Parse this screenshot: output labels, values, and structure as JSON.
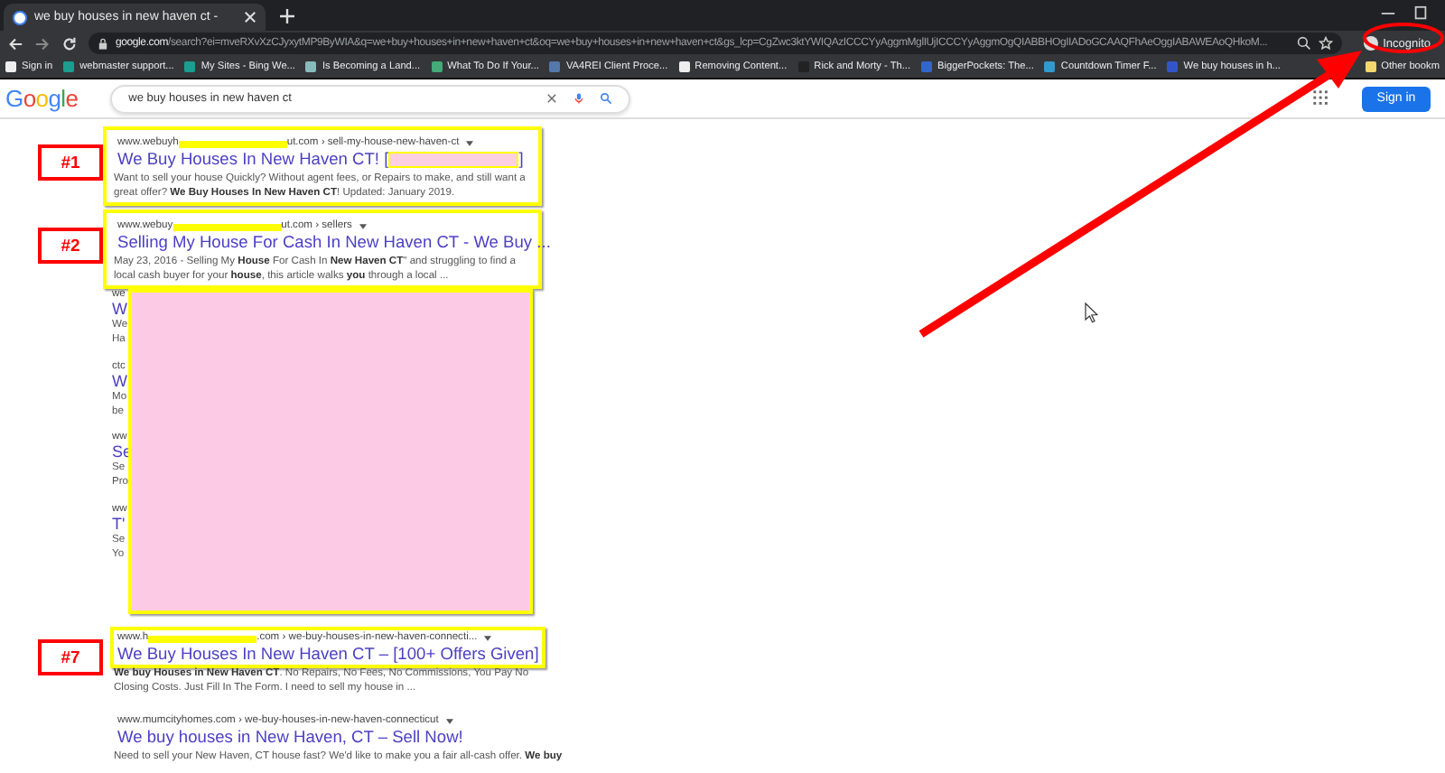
{
  "tab": {
    "title": "we buy houses in new haven ct -"
  },
  "address_bar": {
    "domain": "google.com",
    "path": "/search?ei=mveRXvXzCJyxytMP9ByWIA&q=we+buy+houses+in+new+haven+ct&oq=we+buy+houses+in+new+haven+ct&gs_lcp=CgZwc3ktYWIQAzICCCYyAggmMglIUjICCCYyAggmOgQIABBHOgIIADoGCAAQFhAeOggIABAWEAoQHkoM..."
  },
  "profile": {
    "label": "Incognito"
  },
  "bookmarks": [
    {
      "label": "Sign in"
    },
    {
      "label": "webmaster support..."
    },
    {
      "label": "My Sites - Bing We..."
    },
    {
      "label": "Is Becoming a Land..."
    },
    {
      "label": "What To Do If Your..."
    },
    {
      "label": "VA4REI Client Proce..."
    },
    {
      "label": "Removing Content..."
    },
    {
      "label": "Rick and Morty - Th..."
    },
    {
      "label": "BiggerPockets: The..."
    },
    {
      "label": "Countdown Timer F..."
    },
    {
      "label": "We buy houses in h..."
    }
  ],
  "other_bookmarks": "Other bookm",
  "google": {
    "logo": "Google",
    "query": "we buy houses in new haven ct",
    "sign_in": "Sign in"
  },
  "results_top": [
    {
      "label": "#1",
      "highlighted": true,
      "highlight_snippet": true,
      "url_start": "www.webuyh",
      "url_end": "ut.com › sell-my-house-new-haven-ct",
      "title": "We Buy Houses In New Haven CT! [",
      "title_end": "]",
      "snippet": "Want to sell your house Quickly? Without agent fees, or Repairs to make, and still want a great offer? **We Buy Houses In New Haven CT**! Updated: January 2019."
    },
    {
      "label": "#2",
      "highlighted": true,
      "highlight_snippet": true,
      "url_start": "www.webuy",
      "url_end": "ut.com › sellers",
      "title": "Selling My House For Cash In New Haven CT - We Buy ...",
      "snippet": "May 23, 2016 - Selling My **House** For Cash In **New Haven CT**\" and struggling to find a local cash buyer for your **house**, this article walks **you** through a local ..."
    }
  ],
  "covered_results": [
    {
      "url": "we",
      "title": "W",
      "snippet": [
        "We",
        "Ha"
      ]
    },
    {
      "url": "ctc",
      "title": "W",
      "snippet": [
        "Mo",
        "be"
      ]
    },
    {
      "url": "ww",
      "title": "Se",
      "snippet": [
        "Se",
        "Pro"
      ]
    },
    {
      "url": "ww",
      "title": "T'",
      "snippet": [
        "Se",
        "Yo"
      ]
    }
  ],
  "results_bottom": [
    {
      "label": "#7",
      "highlighted": true,
      "highlight_snippet": false,
      "url_start": "www.h",
      "url_end": ".com › we-buy-houses-in-new-haven-connecti...",
      "title": "We Buy Houses In New Haven CT – [100+ Offers Given]",
      "snippet": "**We buy Houses in New Haven CT**. No Repairs, No Fees, No Commissions, You Pay No Closing Costs. Just Fill In The Form. I need to sell my house in ..."
    },
    {
      "highlighted": false,
      "url_start": "www.mumcityhomes.com › we-buy-houses-in-new-haven-connecticut",
      "title": "We buy houses in New Haven, CT – Sell Now!",
      "snippet": "Need to sell your New Haven, CT house fast? We'd like to make you a fair all-cash offer. **We buy**"
    }
  ]
}
